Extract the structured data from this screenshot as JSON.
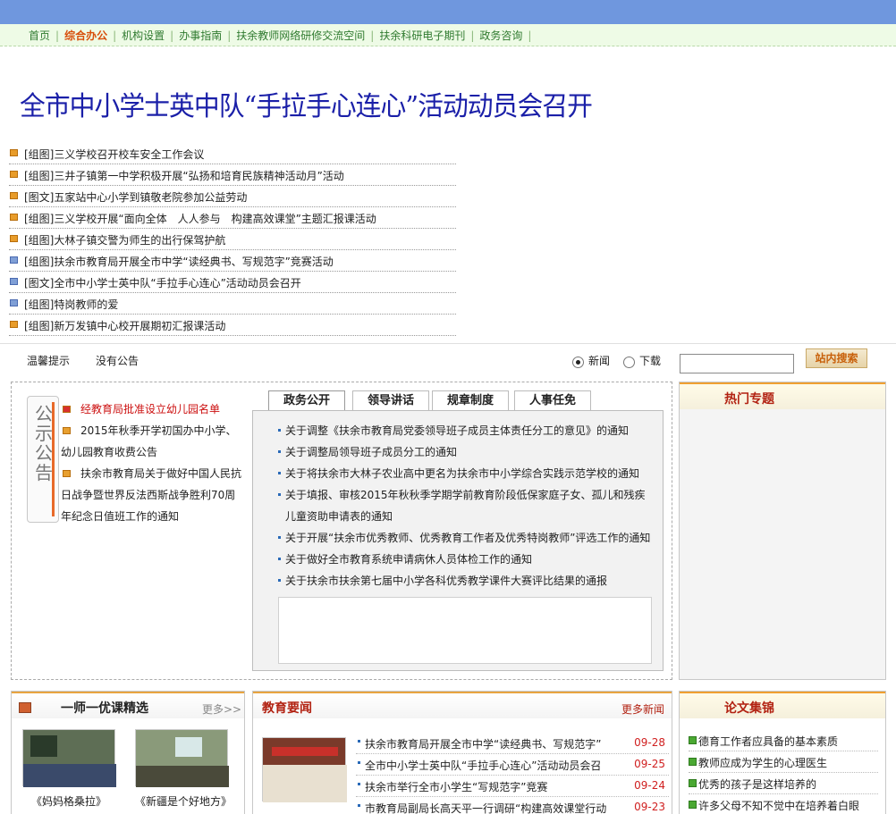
{
  "nav": {
    "items": [
      "首页",
      "综合办公",
      "机构设置",
      "办事指南",
      "扶余教师网络研修交流空间",
      "扶余科研电子期刊",
      "政务咨询"
    ],
    "active_index": 1
  },
  "headline": "全市中小学士英中队“手拉手心连心”活动动员会召开",
  "pic_news": [
    {
      "tag": "[组图]",
      "title": "三义学校召开校车安全工作会议",
      "icon": "orange"
    },
    {
      "tag": "[组图]",
      "title": "三井子镇第一中学积极开展“弘扬和培育民族精神活动月”活动",
      "icon": "orange"
    },
    {
      "tag": "[图文]",
      "title": "五家站中心小学到镇敬老院参加公益劳动",
      "icon": "orange"
    },
    {
      "tag": "[组图]",
      "title": "三义学校开展“面向全体　人人参与　构建高效课堂”主题汇报课活动",
      "icon": "orange"
    },
    {
      "tag": "[组图]",
      "title": "大林子镇交警为师生的出行保驾护航",
      "icon": "orange"
    },
    {
      "tag": "[组图]",
      "title": "扶余市教育局开展全市中学“读经典书、写规范字”竞赛活动",
      "icon": "blue"
    },
    {
      "tag": "[图文]",
      "title": "全市中小学士英中队“手拉手心连心”活动动员会召开",
      "icon": "blue"
    },
    {
      "tag": "[组图]",
      "title": "特岗教师的爱",
      "icon": "blue"
    },
    {
      "tag": "[组图]",
      "title": "新万发镇中心校开展期初汇报课活动",
      "icon": "orange"
    }
  ],
  "notice_bar": {
    "label": "温馨提示",
    "text": "没有公告",
    "radio_news": "新闻",
    "radio_download": "下载",
    "search_value": "",
    "search_button": "站内搜索"
  },
  "gonggao": {
    "label_chars": "公示公告",
    "items": [
      {
        "text": "经教育局批准设立幼儿园名单",
        "hot": true
      },
      {
        "text": "2015年秋季开学初国办中小学、幼儿园教育收费公告",
        "hot": false
      },
      {
        "text": "扶余市教育局关于做好中国人民抗日战争暨世界反法西斯战争胜利70周年纪念日值班工作的通知",
        "hot": false
      }
    ]
  },
  "tabs": {
    "labels": [
      "政务公开",
      "领导讲话",
      "规章制度",
      "人事任免"
    ],
    "active_index": 0,
    "items": [
      "关于调整《扶余市教育局党委领导班子成员主体责任分工的意见》的通知",
      "关于调整局领导班子成员分工的通知",
      "关于将扶余市大林子农业高中更名为扶余市中小学综合实践示范学校的通知",
      "关于填报、审核2015年秋秋季学期学前教育阶段低保家庭子女、孤儿和残疾儿童资助申请表的通知",
      "关于开展“扶余市优秀教师、优秀教育工作者及优秀特岗教师”评选工作的通知",
      "关于做好全市教育系统申请病休人员体检工作的通知",
      "关于扶余市扶余第七届中小学各科优秀教学课件大赛评比结果的通报"
    ]
  },
  "hot_topics": {
    "title": "热门专题"
  },
  "youke": {
    "title": "一师一优课精选",
    "more": "更多>>",
    "captions": [
      "《妈妈格桑拉》",
      "《新疆是个好地方》"
    ]
  },
  "edu_news": {
    "title": "教育要闻",
    "more": "更多新闻",
    "items": [
      {
        "title": "扶余市教育局开展全市中学“读经典书、写规范字”",
        "date": "09-28"
      },
      {
        "title": "全市中小学士英中队“手拉手心连心”活动动员会召",
        "date": "09-25"
      },
      {
        "title": "扶余市举行全市小学生“写规范字”竞赛",
        "date": "09-24"
      },
      {
        "title": "市教育局副局长高天平一行调研“构建高效课堂行动",
        "date": "09-23"
      }
    ]
  },
  "papers": {
    "title": "论文集锦",
    "items": [
      "德育工作者应具备的基本素质",
      "教师应成为学生的心理医生",
      "优秀的孩子是这样培养的",
      "许多父母不知不觉中在培养着白眼"
    ]
  }
}
